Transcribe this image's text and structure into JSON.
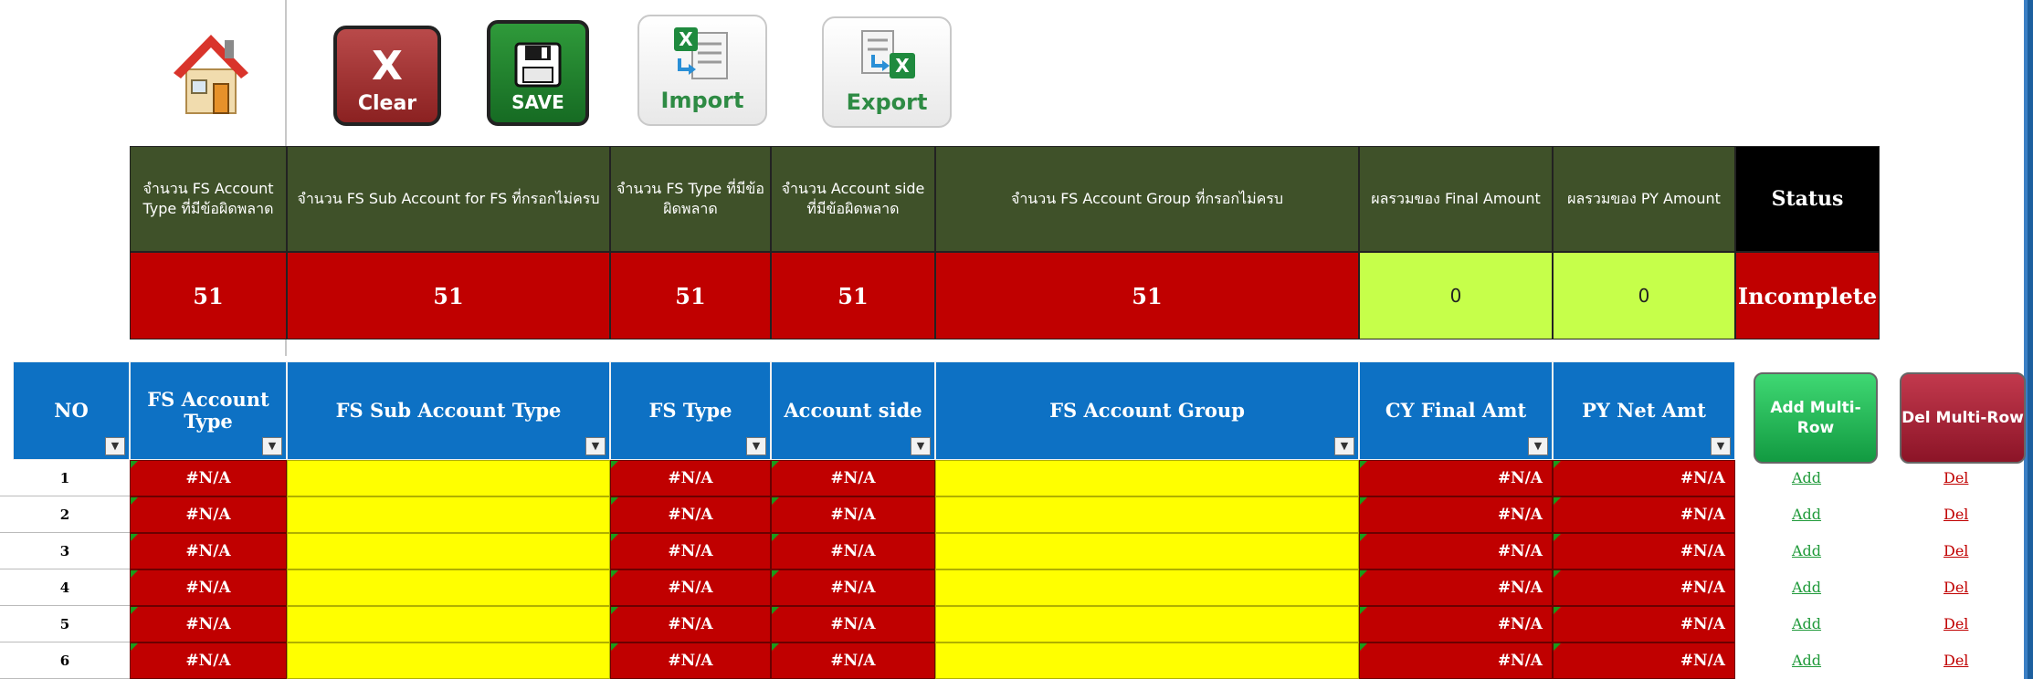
{
  "toolbar": {
    "clear_label": "Clear",
    "clear_symbol": "X",
    "save_label": "SAVE",
    "import_label": "Import",
    "export_label": "Export"
  },
  "summary": {
    "headers": [
      "จำนวน FS Account Type ที่มีข้อผิดพลาด",
      "จำนวน FS Sub Account for FS ที่กรอกไม่ครบ",
      "จำนวน FS Type ที่มีข้อผิดพลาด",
      "จำนวน Account side ที่มีข้อผิดพลาด",
      "จำนวน FS Account Group ที่กรอกไม่ครบ",
      "ผลรวมของ Final Amount",
      "ผลรวมของ PY Amount",
      "Status"
    ],
    "values": [
      "51",
      "51",
      "51",
      "51",
      "51",
      "0",
      "0",
      "Incomplete"
    ]
  },
  "table": {
    "columns": [
      "NO",
      "FS Account Type",
      "FS Sub Account Type",
      "FS Type",
      "Account side",
      "FS Account Group",
      "CY Final Amt",
      "PY Net Amt"
    ],
    "add_multi_label": "Add Multi-Row",
    "del_multi_label": "Del Multi-Row",
    "na": "#N/A",
    "add_link": "Add",
    "del_link": "Del",
    "rows": [
      "1",
      "2",
      "3",
      "4",
      "5",
      "6"
    ]
  },
  "colors": {
    "header_green": "#3f5129",
    "error_red": "#c00000",
    "ok_lime": "#c6ff4a",
    "table_header_blue": "#0d71c4",
    "input_yellow": "#ffff00"
  }
}
